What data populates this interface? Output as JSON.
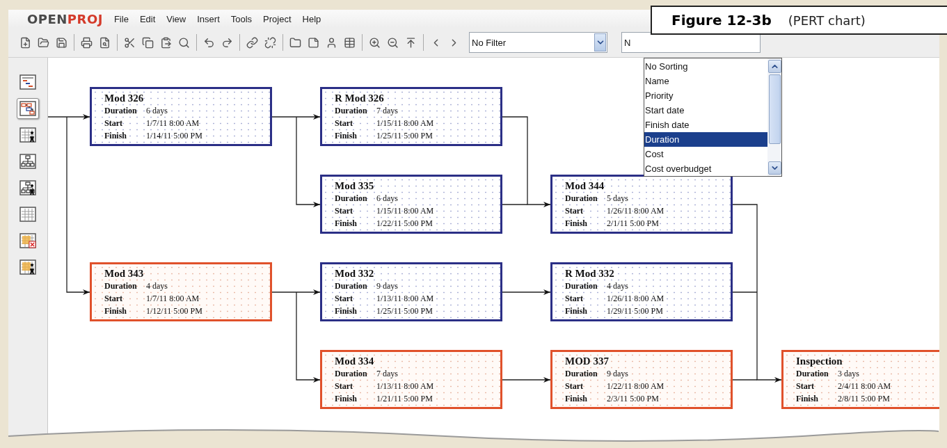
{
  "caption": {
    "number": "Figure 12-3b",
    "title": "(PERT chart)"
  },
  "logo": {
    "first": "OPEN",
    "second": "PROJ"
  },
  "menu": [
    "File",
    "Edit",
    "View",
    "Insert",
    "Tools",
    "Project",
    "Help"
  ],
  "filter": {
    "value": "No Filter"
  },
  "sorting": {
    "value": "N"
  },
  "sort_options": [
    {
      "label": "No Sorting",
      "selected": false
    },
    {
      "label": "Name",
      "selected": false
    },
    {
      "label": "Priority",
      "selected": false
    },
    {
      "label": "Start date",
      "selected": false
    },
    {
      "label": "Finish date",
      "selected": false
    },
    {
      "label": "Duration",
      "selected": true
    },
    {
      "label": "Cost",
      "selected": false
    },
    {
      "label": "Cost overbudget",
      "selected": false
    }
  ],
  "views": [
    {
      "selected": false
    },
    {
      "selected": true
    },
    {
      "selected": false
    },
    {
      "selected": false
    },
    {
      "selected": false
    },
    {
      "selected": false
    },
    {
      "selected": false
    },
    {
      "selected": false
    }
  ],
  "nodes": [
    {
      "title": "Mod 326",
      "critical": false,
      "fields": [
        {
          "label": "Duration",
          "value": "6 days"
        },
        {
          "label": "Start",
          "value": "1/7/11 8:00 AM"
        },
        {
          "label": "Finish",
          "value": "1/14/11 5:00 PM"
        }
      ]
    },
    {
      "title": "R Mod 326",
      "critical": false,
      "fields": [
        {
          "label": "Duration",
          "value": "7 days"
        },
        {
          "label": "Start",
          "value": "1/15/11 8:00 AM"
        },
        {
          "label": "Finish",
          "value": "1/25/11 5:00 PM"
        }
      ]
    },
    {
      "title": "Mod 335",
      "critical": false,
      "fields": [
        {
          "label": "Duration",
          "value": "6 days"
        },
        {
          "label": "Start",
          "value": "1/15/11 8:00 AM"
        },
        {
          "label": "Finish",
          "value": "1/22/11 5:00 PM"
        }
      ]
    },
    {
      "title": "Mod 344",
      "critical": false,
      "fields": [
        {
          "label": "Duration",
          "value": "5 days"
        },
        {
          "label": "Start",
          "value": "1/26/11 8:00 AM"
        },
        {
          "label": "Finish",
          "value": "2/1/11 5:00 PM"
        }
      ]
    },
    {
      "title": "Mod 343",
      "critical": true,
      "fields": [
        {
          "label": "Duration",
          "value": "4 days"
        },
        {
          "label": "Start",
          "value": "1/7/11 8:00 AM"
        },
        {
          "label": "Finish",
          "value": "1/12/11 5:00 PM"
        }
      ]
    },
    {
      "title": "Mod 332",
      "critical": false,
      "fields": [
        {
          "label": "Duration",
          "value": "9 days"
        },
        {
          "label": "Start",
          "value": "1/13/11 8:00 AM"
        },
        {
          "label": "Finish",
          "value": "1/25/11 5:00 PM"
        }
      ]
    },
    {
      "title": "R Mod 332",
      "critical": false,
      "fields": [
        {
          "label": "Duration",
          "value": "4 days"
        },
        {
          "label": "Start",
          "value": "1/26/11 8:00 AM"
        },
        {
          "label": "Finish",
          "value": "1/29/11 5:00 PM"
        }
      ]
    },
    {
      "title": "Mod 334",
      "critical": true,
      "fields": [
        {
          "label": "Duration",
          "value": "7 days"
        },
        {
          "label": "Start",
          "value": "1/13/11 8:00 AM"
        },
        {
          "label": "Finish",
          "value": "1/21/11 5:00 PM"
        }
      ]
    },
    {
      "title": "MOD 337",
      "critical": true,
      "fields": [
        {
          "label": "Duration",
          "value": "9 days"
        },
        {
          "label": "Start",
          "value": "1/22/11 8:00 AM"
        },
        {
          "label": "Finish",
          "value": "2/3/11 5:00 PM"
        }
      ]
    },
    {
      "title": "Inspection",
      "critical": true,
      "fields": [
        {
          "label": "Duration",
          "value": "3 days"
        },
        {
          "label": "Start",
          "value": "2/4/11 8:00 AM"
        },
        {
          "label": "Finish",
          "value": "2/8/11 5:00 PM"
        }
      ]
    }
  ]
}
